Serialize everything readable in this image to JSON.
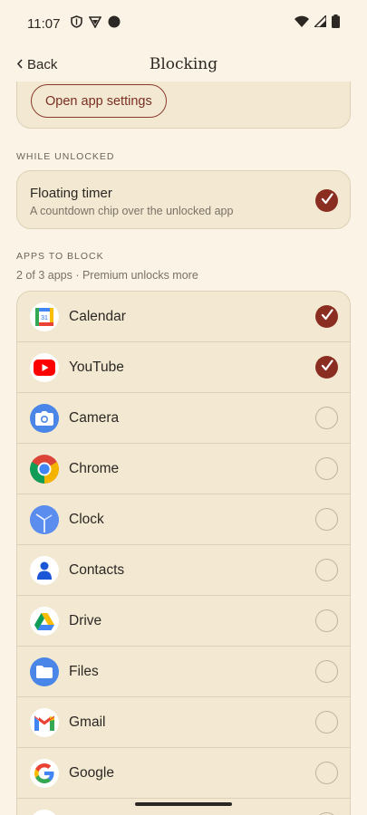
{
  "status": {
    "time": "11:07",
    "left_icons": [
      "shield-icon",
      "vpn-icon",
      "dot-icon"
    ],
    "right_icons": [
      "wifi-icon",
      "signal-icon",
      "battery-icon"
    ]
  },
  "header": {
    "back_label": "Back",
    "title": "Blocking"
  },
  "top_card": {
    "open_settings_label": "Open app settings"
  },
  "while_unlocked": {
    "section_label": "WHILE UNLOCKED",
    "floating_timer": {
      "title": "Floating timer",
      "description": "A countdown chip over the unlocked app",
      "checked": true
    }
  },
  "apps_to_block": {
    "section_label": "APPS TO BLOCK",
    "subtitle": "2 of 3 apps · Premium unlocks more",
    "apps": [
      {
        "name": "Calendar",
        "icon": "calendar-icon",
        "checked": true
      },
      {
        "name": "YouTube",
        "icon": "youtube-icon",
        "checked": true
      },
      {
        "name": "Camera",
        "icon": "camera-icon",
        "checked": false
      },
      {
        "name": "Chrome",
        "icon": "chrome-icon",
        "checked": false
      },
      {
        "name": "Clock",
        "icon": "clock-icon",
        "checked": false
      },
      {
        "name": "Contacts",
        "icon": "contacts-icon",
        "checked": false
      },
      {
        "name": "Drive",
        "icon": "drive-icon",
        "checked": false
      },
      {
        "name": "Files",
        "icon": "files-icon",
        "checked": false
      },
      {
        "name": "Gmail",
        "icon": "gmail-icon",
        "checked": false
      },
      {
        "name": "Google",
        "icon": "google-icon",
        "checked": false
      }
    ]
  },
  "colors": {
    "background": "#fbf3e6",
    "card": "#f3e9d2",
    "accent": "#8a2e22"
  }
}
